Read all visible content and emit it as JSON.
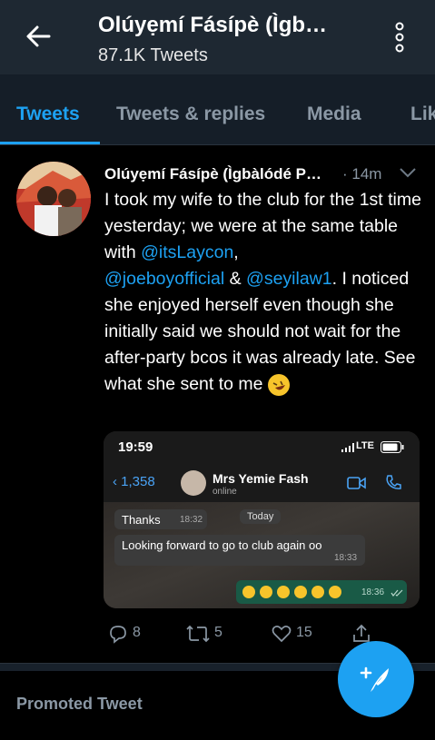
{
  "header": {
    "title": "Olúyẹmí Fásípè (Ìgb…",
    "subtitle": "87.1K Tweets"
  },
  "tabs": [
    {
      "label": "Tweets"
    },
    {
      "label": "Tweets & replies"
    },
    {
      "label": "Media"
    },
    {
      "label": "Lik"
    }
  ],
  "tweet": {
    "author": "Olúyẹmí Fásípè (Ìgbàlódé P…",
    "time": "· 14m",
    "text_parts": {
      "p1": "I took my wife to the club for the 1st time yesterday; we were at the same table with ",
      "m1": "@itsLaycon",
      "p2": ",",
      "m2": "@joeboyofficial",
      "p3": " & ",
      "m3": "@seyilaw1",
      "p4": ". I noticed she enjoyed herself even though she initially said we should not wait for the after-party bcos it was already late. See what she sent to me "
    },
    "media": {
      "status_time": "19:59",
      "network": "LTE",
      "back_count": "1,358",
      "contact_name": "Mrs Yemie Fash",
      "contact_status": "online",
      "day_label": "Today",
      "msg1_text": "Thanks",
      "msg1_time": "18:32",
      "msg2_text": "Looking forward to go to club again oo",
      "msg2_time": "18:33",
      "msg3_time": "18:36"
    },
    "actions": {
      "replies": "8",
      "retweets": "5",
      "likes": "15"
    }
  },
  "promoted_label": "Promoted Tweet",
  "colors": {
    "accent": "#1da1f2",
    "header_bg": "#1e2832",
    "muted": "#8b98a5"
  }
}
